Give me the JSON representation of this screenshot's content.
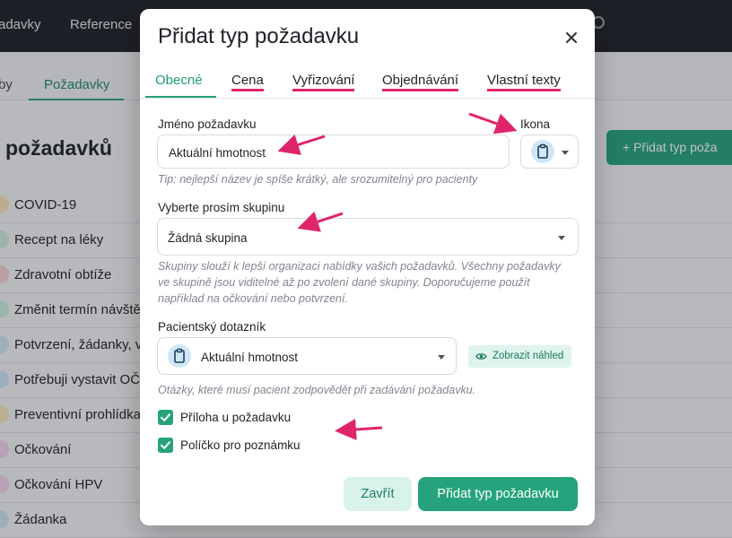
{
  "background": {
    "nav": [
      "adavky",
      "Reference"
    ],
    "subnav": [
      "by",
      "Požadavky"
    ],
    "page_title": "požadavků",
    "add_button": "+  Přidat typ poža",
    "list": [
      {
        "label": "COVID-19",
        "color": "#f6e7b8"
      },
      {
        "label": "Recept na léky",
        "color": "#cdeedd"
      },
      {
        "label": "Zdravotní obtíže",
        "color": "#f7d2cf"
      },
      {
        "label": "Změnit termín návště",
        "color": "#cdeedd"
      },
      {
        "label": "Potvrzení, žádanky, vy",
        "color": "#cfe7f6"
      },
      {
        "label": "Potřebuji vystavit OČ",
        "color": "#cfe7f6"
      },
      {
        "label": "Preventivní prohlídka",
        "color": "#f6e7b8"
      },
      {
        "label": "Očkování",
        "color": "#f3d3ea"
      },
      {
        "label": "Očkování HPV",
        "color": "#f3d3ea"
      },
      {
        "label": "Žádanka",
        "color": "#cfe7f6"
      }
    ]
  },
  "modal": {
    "title": "Přidat typ požadavku",
    "tabs": [
      "Obecné",
      "Cena",
      "Vyřizování",
      "Objednávání",
      "Vlastní texty"
    ],
    "name_label": "Jméno požadavku",
    "name_value": "Aktuální hmotnost",
    "icon_label": "Ikona",
    "icon_name": "clipboard-icon",
    "name_hint": "Tip: nejlepší název je spíše krátký, ale srozumitelný pro pacienty",
    "group_label": "Vyberte prosím skupinu",
    "group_value": "Žádná skupina",
    "group_hint_1": "Skupiny slouží k lepší organizaci nabídky vašich požadavků. Všechny požadavky",
    "group_hint_2": "ve skupině jsou viditelné až po zvolení dané skupiny. Doporučujeme použít",
    "group_hint_3": "například na očkování nebo potvrzení.",
    "questionnaire_label": "Pacientský dotazník",
    "questionnaire_value": "Aktuální hmotnost",
    "preview_label": "Zobrazit náhled",
    "questionnaire_hint": "Otázky, které musí pacient zodpovědět při zadávání požadavku.",
    "attachment_label": "Příloha u požadavku",
    "attachment_checked": true,
    "note_label": "Políčko pro poznámku",
    "note_checked": true,
    "close_button": "Zavřít",
    "submit_button": "Přidat typ požadavku"
  },
  "colors": {
    "accent": "#26a37c",
    "annotation": "#e0246b"
  }
}
